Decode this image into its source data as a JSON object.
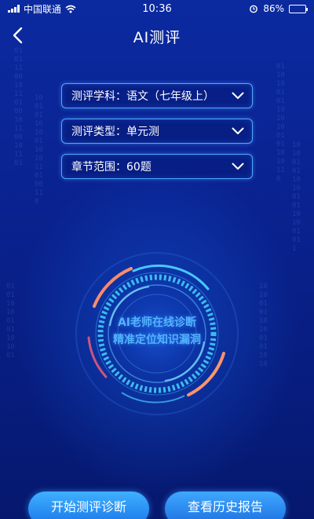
{
  "status_bar": {
    "carrier": "中国联通",
    "time": "10:36",
    "battery_percent": "86%",
    "battery_level": 0.86
  },
  "nav": {
    "title": "AI测评"
  },
  "filters": [
    {
      "label": "测评学科：语文（七年级上）"
    },
    {
      "label": "测评类型：单元测"
    },
    {
      "label": "章节范围：60题"
    }
  ],
  "radar": {
    "line1": "AI老师在线诊断",
    "line2": "精准定位知识漏洞"
  },
  "actions": {
    "start_label": "开始测评诊断",
    "history_label": "查看历史报告"
  },
  "colors": {
    "accent": "#4fa9ff",
    "ring_orange": "#ff8a5c",
    "ring_cyan": "#3fd6ff"
  }
}
